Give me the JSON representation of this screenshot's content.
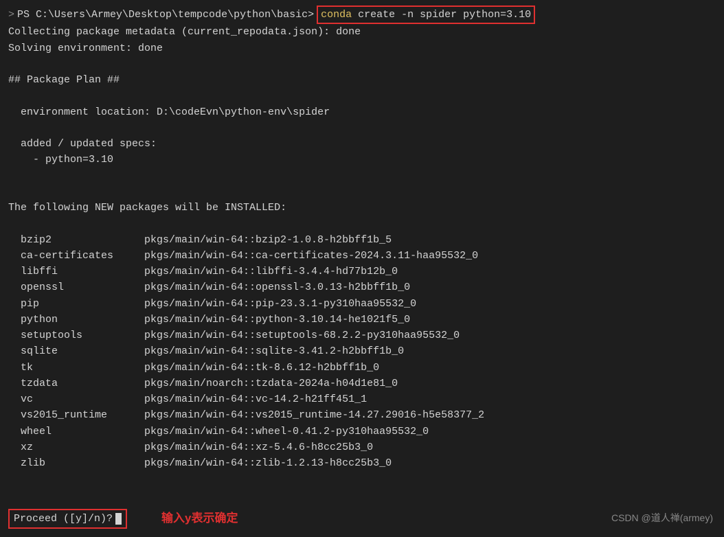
{
  "prompt": {
    "marker": ">",
    "path": "PS C:\\Users\\Armey\\Desktop\\tempcode\\python\\basic>",
    "cmd_keyword": "conda",
    "cmd_rest": " create -n spider python=3.10"
  },
  "output": {
    "collecting": "Collecting package metadata (current_repodata.json): done",
    "solving": "Solving environment: done",
    "plan_heading": "## Package Plan ##",
    "env_location": "  environment location: D:\\codeEvn\\python-env\\spider",
    "specs_heading": "  added / updated specs:",
    "specs_item": "    - python=3.10",
    "new_pkgs_heading": "The following NEW packages will be INSTALLED:"
  },
  "packages": [
    {
      "name": "bzip2",
      "spec": "pkgs/main/win-64::bzip2-1.0.8-h2bbff1b_5"
    },
    {
      "name": "ca-certificates",
      "spec": "pkgs/main/win-64::ca-certificates-2024.3.11-haa95532_0"
    },
    {
      "name": "libffi",
      "spec": "pkgs/main/win-64::libffi-3.4.4-hd77b12b_0"
    },
    {
      "name": "openssl",
      "spec": "pkgs/main/win-64::openssl-3.0.13-h2bbff1b_0"
    },
    {
      "name": "pip",
      "spec": "pkgs/main/win-64::pip-23.3.1-py310haa95532_0"
    },
    {
      "name": "python",
      "spec": "pkgs/main/win-64::python-3.10.14-he1021f5_0"
    },
    {
      "name": "setuptools",
      "spec": "pkgs/main/win-64::setuptools-68.2.2-py310haa95532_0"
    },
    {
      "name": "sqlite",
      "spec": "pkgs/main/win-64::sqlite-3.41.2-h2bbff1b_0"
    },
    {
      "name": "tk",
      "spec": "pkgs/main/win-64::tk-8.6.12-h2bbff1b_0"
    },
    {
      "name": "tzdata",
      "spec": "pkgs/main/noarch::tzdata-2024a-h04d1e81_0"
    },
    {
      "name": "vc",
      "spec": "pkgs/main/win-64::vc-14.2-h21ff451_1"
    },
    {
      "name": "vs2015_runtime",
      "spec": "pkgs/main/win-64::vs2015_runtime-14.27.29016-h5e58377_2"
    },
    {
      "name": "wheel",
      "spec": "pkgs/main/win-64::wheel-0.41.2-py310haa95532_0"
    },
    {
      "name": "xz",
      "spec": "pkgs/main/win-64::xz-5.4.6-h8cc25b3_0"
    },
    {
      "name": "zlib",
      "spec": "pkgs/main/win-64::zlib-1.2.13-h8cc25b3_0"
    }
  ],
  "proceed": {
    "text": "Proceed ([y]/n)?"
  },
  "annotation": "输入y表示确定",
  "watermark": "CSDN @道人禅(armey)"
}
